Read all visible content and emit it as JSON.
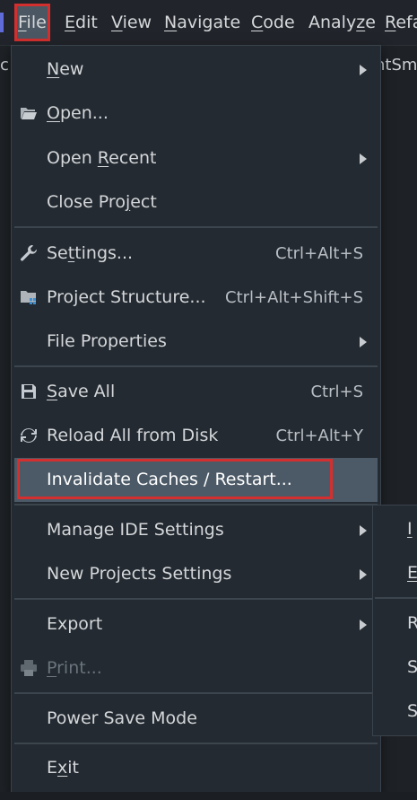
{
  "menubar": {
    "items": [
      {
        "pre": "",
        "mn": "F",
        "post": "ile"
      },
      {
        "pre": "",
        "mn": "E",
        "post": "dit"
      },
      {
        "pre": "",
        "mn": "V",
        "post": "iew"
      },
      {
        "pre": "",
        "mn": "N",
        "post": "avigate"
      },
      {
        "pre": "",
        "mn": "C",
        "post": "ode"
      },
      {
        "pre": "Analy",
        "mn": "z",
        "post": "e"
      },
      {
        "pre": "",
        "mn": "R",
        "post": "efa"
      }
    ]
  },
  "editor": {
    "tab_text": "ntSms"
  },
  "file_menu": {
    "new": {
      "pre": "",
      "mn": "N",
      "post": "ew"
    },
    "open": {
      "pre": "",
      "mn": "O",
      "post": "pen..."
    },
    "open_recent": {
      "pre": "Open ",
      "mn": "R",
      "post": "ecent"
    },
    "close_project": {
      "pre": "Close Pro",
      "mn": "j",
      "post": "ect"
    },
    "settings": {
      "pre": "Se",
      "mn": "t",
      "post": "tings...",
      "shortcut": "Ctrl+Alt+S"
    },
    "project_structure": {
      "label": "Project Structure...",
      "shortcut": "Ctrl+Alt+Shift+S"
    },
    "file_properties": {
      "label": "File Properties"
    },
    "save_all": {
      "pre": "",
      "mn": "S",
      "post": "ave All",
      "shortcut": "Ctrl+S"
    },
    "reload_all": {
      "label": "Reload All from Disk",
      "shortcut": "Ctrl+Alt+Y"
    },
    "invalidate_caches": {
      "label": "Invalidate Caches / Restart..."
    },
    "manage_ide_settings": {
      "label": "Manage IDE Settings"
    },
    "new_projects_settings": {
      "label": "New Projects Settings"
    },
    "export": {
      "label": "Export"
    },
    "print": {
      "pre": "",
      "mn": "P",
      "post": "rint..."
    },
    "power_save_mode": {
      "label": "Power Save Mode"
    },
    "exit": {
      "pre": "E",
      "mn": "x",
      "post": "it"
    }
  },
  "submenu": {
    "items": [
      {
        "pre": "",
        "mn": "I",
        "post": ""
      },
      {
        "pre": "",
        "mn": "E",
        "post": ""
      },
      {
        "pre": "",
        "mn": "R",
        "post": ""
      },
      {
        "pre": "",
        "mn": "S",
        "post": ""
      },
      {
        "pre": "",
        "mn": "S",
        "post": ""
      }
    ]
  },
  "colors": {
    "highlight": "#4c5a67",
    "red_outline": "#d32f2f",
    "menu_bg": "#232a31"
  }
}
